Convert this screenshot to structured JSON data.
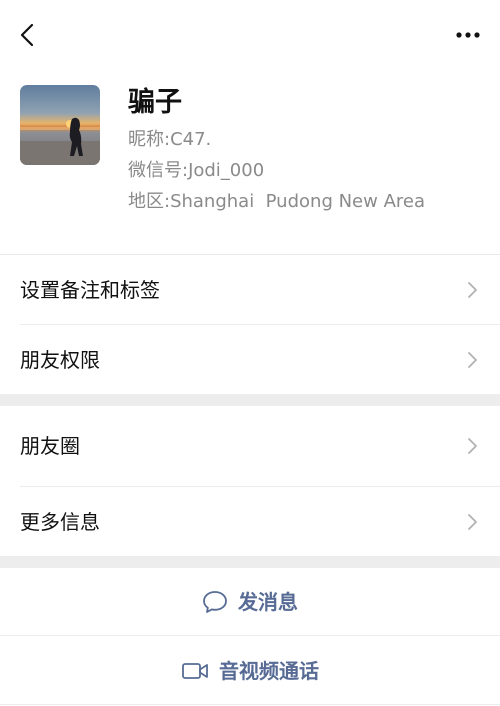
{
  "header": {
    "back_icon": "chevron-left-icon",
    "more_icon": "more-dots-icon"
  },
  "profile": {
    "name": "骗子",
    "nickname": "昵称:C47.",
    "wechat_id": "微信号:Jodi_000",
    "region": "地区:Shanghai  Pudong New Area",
    "avatar_description": "sunset-beach-photo"
  },
  "rows": [
    {
      "label": "设置备注和标签"
    },
    {
      "label": "朋友权限"
    },
    {
      "label": "朋友圈"
    },
    {
      "label": "更多信息"
    }
  ],
  "actions": {
    "message_label": "发消息",
    "call_label": "音视频通话"
  },
  "colors": {
    "link": "#576b95",
    "secondary_text": "#8a8a8a",
    "section_gap": "#ededed"
  }
}
